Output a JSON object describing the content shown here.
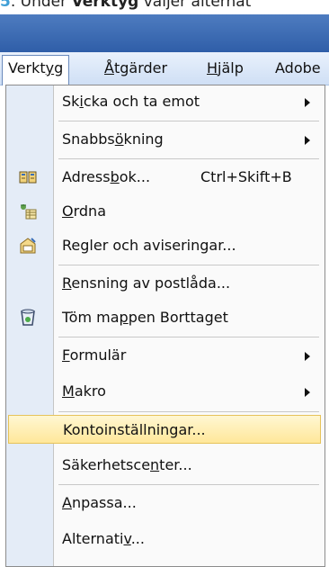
{
  "caption": {
    "number": "5",
    "part1": ". Under ",
    "bold": "Verktyg",
    "part2": " väljer alternat"
  },
  "menubar": {
    "items": [
      {
        "pre": "Verkt",
        "u": "y",
        "post": "g"
      },
      {
        "pre": "",
        "u": "Å",
        "post": "tgärder"
      },
      {
        "pre": "",
        "u": "H",
        "post": "jälp"
      },
      {
        "pre": "Adobe",
        "u": "",
        "post": ""
      }
    ]
  },
  "menu": {
    "items": [
      {
        "pre": "Sk",
        "u": "i",
        "post": "cka och ta emot",
        "submenu": true
      },
      {
        "pre": "Snabbs",
        "u": "ö",
        "post": "kning",
        "submenu": true
      },
      {
        "pre": "Adress",
        "u": "b",
        "post": "ok...",
        "shortcut": "Ctrl+Skift+B",
        "icon": "address-book-icon"
      },
      {
        "pre": "",
        "u": "O",
        "post": "rdna",
        "icon": "organize-icon"
      },
      {
        "pre": "Regler och aviseringar...",
        "u": "",
        "post": "",
        "icon": "rules-icon"
      },
      {
        "pre": "",
        "u": "R",
        "post": "ensning av postlåda..."
      },
      {
        "pre": "Töm ma",
        "u": "p",
        "post": "pen Borttaget",
        "icon": "empty-trash-icon"
      },
      {
        "pre": "",
        "u": "F",
        "post": "ormulär",
        "submenu": true
      },
      {
        "pre": "",
        "u": "M",
        "post": "akro",
        "submenu": true
      },
      {
        "pre": "Kontoinställningar...",
        "u": "",
        "post": "",
        "highlighted": true
      },
      {
        "pre": "Säkerhetsce",
        "u": "n",
        "post": "ter..."
      },
      {
        "pre": "",
        "u": "A",
        "post": "npassa..."
      },
      {
        "pre": "Alternati",
        "u": "v",
        "post": "..."
      }
    ]
  },
  "colors": {
    "highlight": "#ffe79a",
    "gutter": "#e4ecf7",
    "titlebar": "#2f5ea8"
  }
}
